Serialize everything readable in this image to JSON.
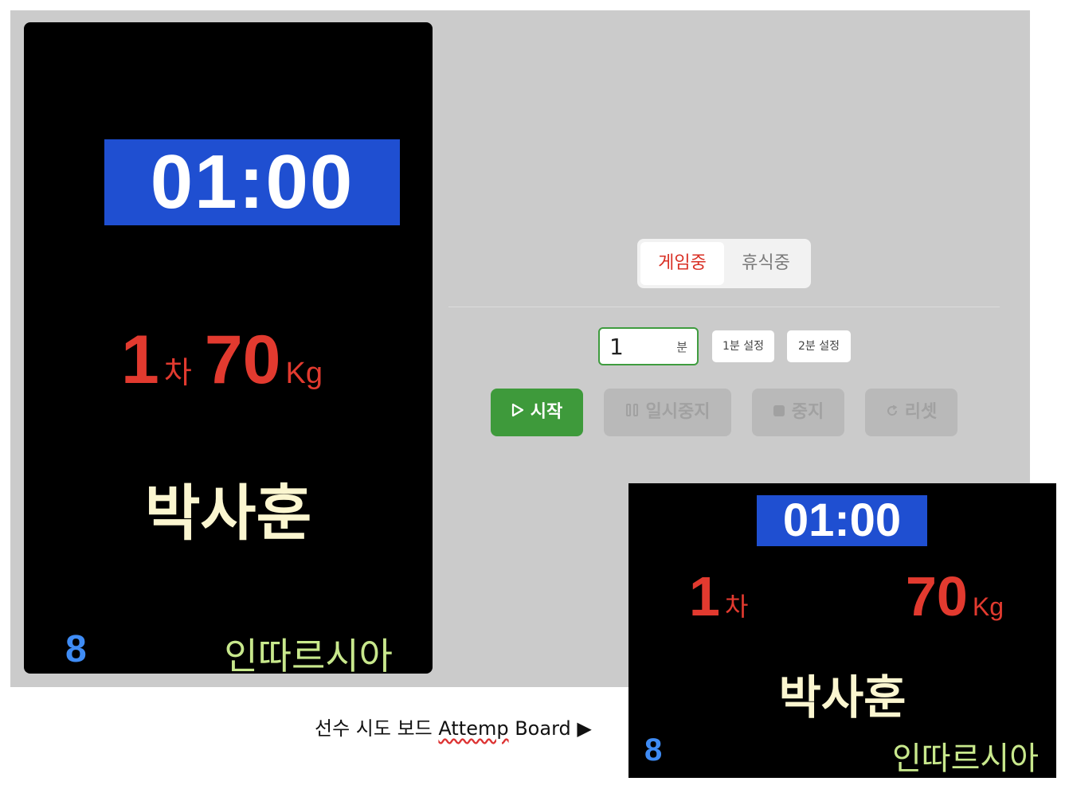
{
  "main_board": {
    "timer": "01:00",
    "attempt_number": "1",
    "attempt_unit": "차",
    "weight_value": "70",
    "weight_unit": "Kg",
    "athlete_name": "박사훈",
    "bib_number": "8",
    "team": "인따르시아"
  },
  "controls": {
    "mode_tabs": [
      {
        "label": "게임중",
        "active": true
      },
      {
        "label": "휴식중",
        "active": false
      }
    ],
    "minutes_input": {
      "value": "1",
      "unit": "분"
    },
    "presets": [
      "1분 설정",
      "2분 설정"
    ],
    "buttons": {
      "start": "시작",
      "pause": "일시중지",
      "stop": "중지",
      "reset": "리셋"
    },
    "colors": {
      "start": "#3e9a3b",
      "active_tab_text": "#d93025",
      "disabled": "#b9b9b9"
    }
  },
  "preview_board": {
    "timer": "01:00",
    "attempt_number": "1",
    "attempt_unit": "차",
    "weight_value": "70",
    "weight_unit": "Kg",
    "athlete_name": "박사훈",
    "bib_number": "8",
    "team": "인따르시아"
  },
  "caption": {
    "prefix": "선수 시도 보드 ",
    "misspelled_word": "Attemp",
    "suffix": " Board ▶"
  }
}
